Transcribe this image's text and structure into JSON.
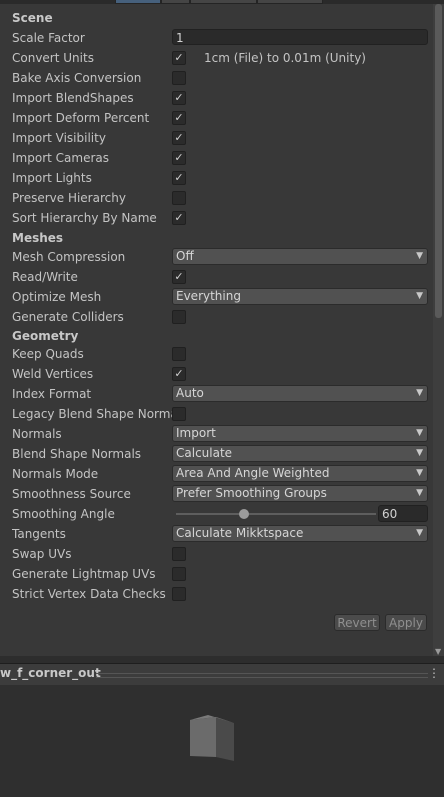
{
  "sections": {
    "scene": "Scene",
    "meshes": "Meshes",
    "geometry": "Geometry"
  },
  "scene": {
    "scale_factor": {
      "label": "Scale Factor",
      "value": "1"
    },
    "convert_units": {
      "label": "Convert Units",
      "checked": true,
      "note": "1cm (File) to 0.01m (Unity)"
    },
    "bake_axis": {
      "label": "Bake Axis Conversion",
      "checked": false
    },
    "import_blendshapes": {
      "label": "Import BlendShapes",
      "checked": true
    },
    "import_deform": {
      "label": "Import Deform Percent",
      "checked": true
    },
    "import_visibility": {
      "label": "Import Visibility",
      "checked": true
    },
    "import_cameras": {
      "label": "Import Cameras",
      "checked": true
    },
    "import_lights": {
      "label": "Import Lights",
      "checked": true
    },
    "preserve_hierarchy": {
      "label": "Preserve Hierarchy",
      "checked": false
    },
    "sort_hierarchy": {
      "label": "Sort Hierarchy By Name",
      "checked": true
    }
  },
  "meshes": {
    "mesh_compression": {
      "label": "Mesh Compression",
      "value": "Off"
    },
    "read_write": {
      "label": "Read/Write",
      "checked": true
    },
    "optimize_mesh": {
      "label": "Optimize Mesh",
      "value": "Everything"
    },
    "generate_colliders": {
      "label": "Generate Colliders",
      "checked": false
    }
  },
  "geometry": {
    "keep_quads": {
      "label": "Keep Quads",
      "checked": false
    },
    "weld_vertices": {
      "label": "Weld Vertices",
      "checked": true
    },
    "index_format": {
      "label": "Index Format",
      "value": "Auto"
    },
    "legacy_blend": {
      "label": "Legacy Blend Shape Norma",
      "checked": false
    },
    "normals": {
      "label": "Normals",
      "value": "Import"
    },
    "blend_normals": {
      "label": "Blend Shape Normals",
      "value": "Calculate"
    },
    "normals_mode": {
      "label": "Normals Mode",
      "value": "Area And Angle Weighted"
    },
    "smoothness_source": {
      "label": "Smoothness Source",
      "value": "Prefer Smoothing Groups"
    },
    "smoothing_angle": {
      "label": "Smoothing Angle",
      "value": "60",
      "min": 0,
      "max": 180
    },
    "tangents": {
      "label": "Tangents",
      "value": "Calculate Mikktspace"
    },
    "swap_uvs": {
      "label": "Swap UVs",
      "checked": false
    },
    "lightmap_uvs": {
      "label": "Generate Lightmap UVs",
      "checked": false
    },
    "strict_vertex": {
      "label": "Strict Vertex Data Checks",
      "checked": false
    }
  },
  "buttons": {
    "revert": "Revert",
    "apply": "Apply"
  },
  "preview": {
    "title": "w_f_corner_out"
  },
  "glyphs": {
    "check": "✓",
    "caret": "▼",
    "kebab": "⋮",
    "scroll_down": "▼"
  }
}
